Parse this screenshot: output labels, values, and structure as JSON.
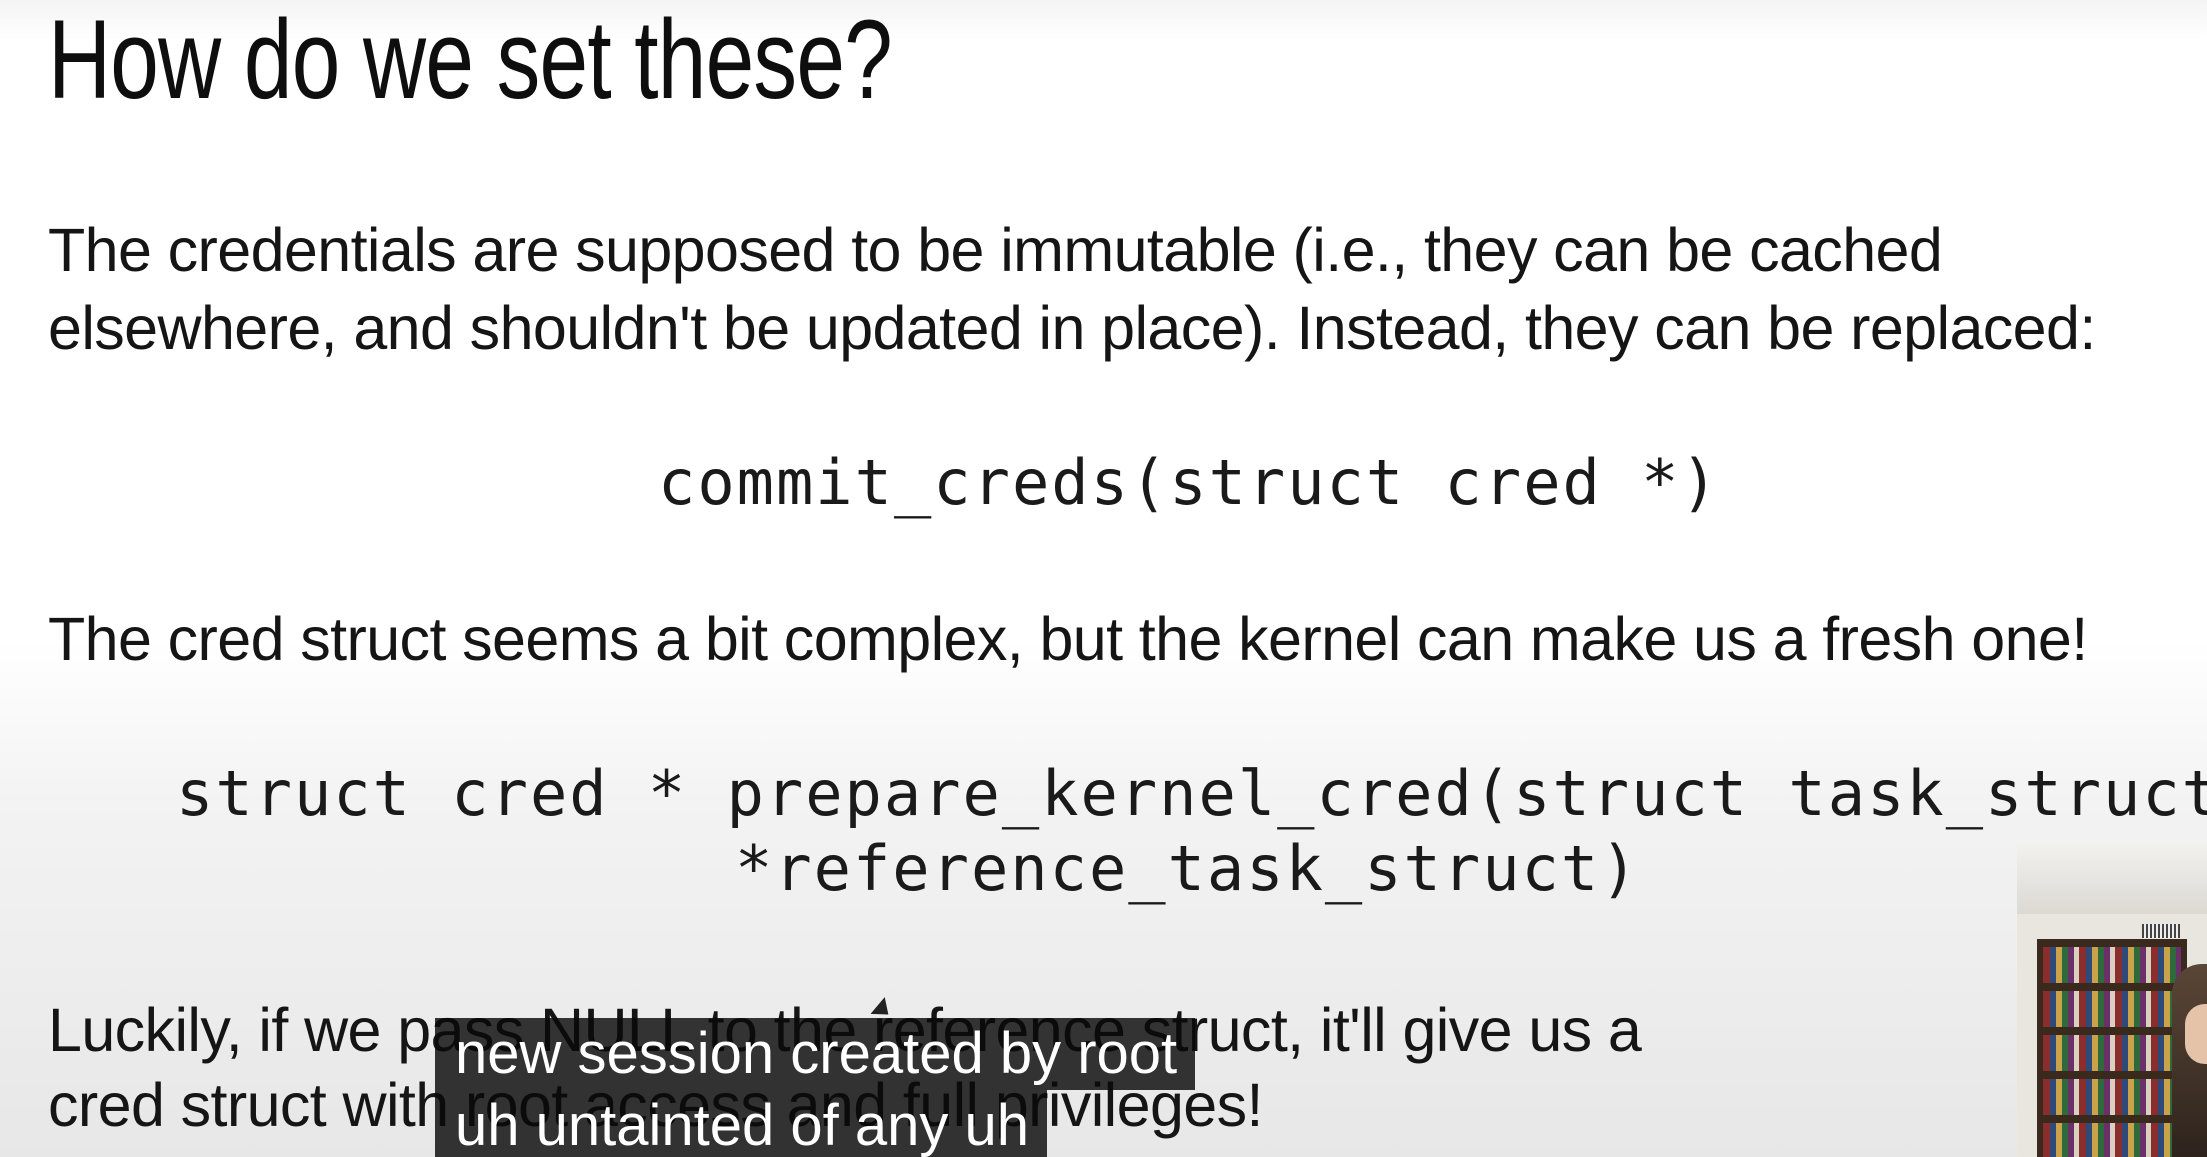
{
  "slide": {
    "title": "How do we set these?",
    "paragraph_1": {
      "line_1": "The credentials are supposed to be immutable (i.e., they can be cached",
      "line_2": "elsewhere, and shouldn't be updated in place). Instead, they can be replaced:"
    },
    "code_1": "commit_creds(struct cred *)",
    "paragraph_2": "The cred struct seems a bit complex, but the kernel can make us a fresh one!",
    "code_2": {
      "line_1": "struct cred * prepare_kernel_cred(struct task_struct",
      "line_2": "*reference_task_struct)"
    },
    "paragraph_3": {
      "line_1": "Luckily, if we pass NULL to the reference struct, it'll give us a",
      "line_2": "cred struct with root access and full privileges!"
    }
  },
  "captions": {
    "line_1": "new session created by root",
    "line_2": "uh untainted of any uh"
  }
}
